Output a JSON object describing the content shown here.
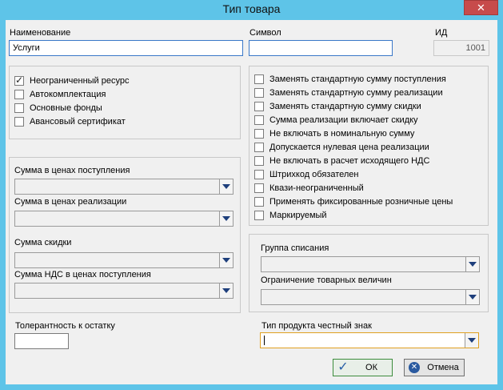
{
  "window": {
    "title": "Тип товара",
    "close_glyph": "✕"
  },
  "fields": {
    "name_label": "Наименование",
    "name_value": "Услуги",
    "symbol_label": "Символ",
    "symbol_value": "",
    "id_label": "ИД",
    "id_value": "1001"
  },
  "left_checks": [
    {
      "label": "Неограниченный ресурс",
      "checked": true
    },
    {
      "label": "Автокомплектация",
      "checked": false
    },
    {
      "label": "Основные фонды",
      "checked": false
    },
    {
      "label": "Авансовый сертификат",
      "checked": false
    }
  ],
  "right_checks": [
    {
      "label": "Заменять стандартную сумму поступления",
      "checked": false
    },
    {
      "label": "Заменять стандартную сумму реализации",
      "checked": false
    },
    {
      "label": "Заменять стандартную сумму скидки",
      "checked": false
    },
    {
      "label": "Сумма реализации включает скидку",
      "checked": false
    },
    {
      "label": "Не включать в номинальную сумму",
      "checked": false
    },
    {
      "label": "Допускается нулевая цена реализации",
      "checked": false
    },
    {
      "label": "Не включать в расчет исходящего НДС",
      "checked": false
    },
    {
      "label": "Штрихкод обязателен",
      "checked": false
    },
    {
      "label": "Квази-неограниченный",
      "checked": false
    },
    {
      "label": "Применять фиксированные розничные цены",
      "checked": false
    },
    {
      "label": "Маркируемый",
      "checked": false
    }
  ],
  "sums": {
    "purchase_label": "Сумма в ценах поступления",
    "sale_label": "Сумма в ценах реализации",
    "discount_label": "Сумма скидки",
    "vat_label": "Сумма НДС в ценах поступления"
  },
  "writeoff": {
    "group_label": "Группа списания",
    "limit_label": "Ограничение товарных величин"
  },
  "tolerance": {
    "label": "Толерантность к остатку",
    "value": ""
  },
  "honest_sign": {
    "label": "Тип продукта честный знак",
    "value": ""
  },
  "buttons": {
    "ok": "ОК",
    "cancel": "Отмена"
  },
  "icons": {
    "ok": "check-icon",
    "cancel": "cancel-icon",
    "combo": "chevron-down-icon"
  }
}
